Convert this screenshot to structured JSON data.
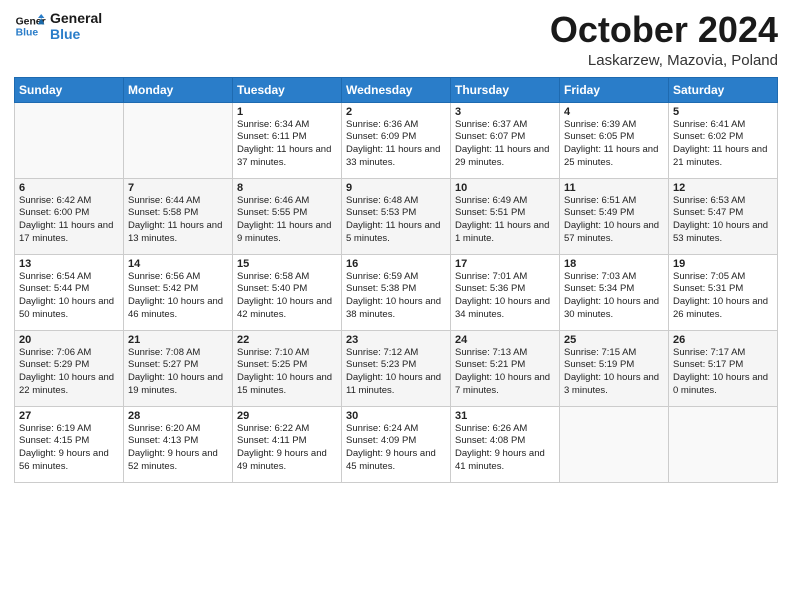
{
  "header": {
    "logo_line1": "General",
    "logo_line2": "Blue",
    "month_title": "October 2024",
    "location": "Laskarzew, Mazovia, Poland"
  },
  "days_of_week": [
    "Sunday",
    "Monday",
    "Tuesday",
    "Wednesday",
    "Thursday",
    "Friday",
    "Saturday"
  ],
  "weeks": [
    [
      {
        "day": "",
        "sunrise": "",
        "sunset": "",
        "daylight": ""
      },
      {
        "day": "",
        "sunrise": "",
        "sunset": "",
        "daylight": ""
      },
      {
        "day": "1",
        "sunrise": "Sunrise: 6:34 AM",
        "sunset": "Sunset: 6:11 PM",
        "daylight": "Daylight: 11 hours and 37 minutes."
      },
      {
        "day": "2",
        "sunrise": "Sunrise: 6:36 AM",
        "sunset": "Sunset: 6:09 PM",
        "daylight": "Daylight: 11 hours and 33 minutes."
      },
      {
        "day": "3",
        "sunrise": "Sunrise: 6:37 AM",
        "sunset": "Sunset: 6:07 PM",
        "daylight": "Daylight: 11 hours and 29 minutes."
      },
      {
        "day": "4",
        "sunrise": "Sunrise: 6:39 AM",
        "sunset": "Sunset: 6:05 PM",
        "daylight": "Daylight: 11 hours and 25 minutes."
      },
      {
        "day": "5",
        "sunrise": "Sunrise: 6:41 AM",
        "sunset": "Sunset: 6:02 PM",
        "daylight": "Daylight: 11 hours and 21 minutes."
      }
    ],
    [
      {
        "day": "6",
        "sunrise": "Sunrise: 6:42 AM",
        "sunset": "Sunset: 6:00 PM",
        "daylight": "Daylight: 11 hours and 17 minutes."
      },
      {
        "day": "7",
        "sunrise": "Sunrise: 6:44 AM",
        "sunset": "Sunset: 5:58 PM",
        "daylight": "Daylight: 11 hours and 13 minutes."
      },
      {
        "day": "8",
        "sunrise": "Sunrise: 6:46 AM",
        "sunset": "Sunset: 5:55 PM",
        "daylight": "Daylight: 11 hours and 9 minutes."
      },
      {
        "day": "9",
        "sunrise": "Sunrise: 6:48 AM",
        "sunset": "Sunset: 5:53 PM",
        "daylight": "Daylight: 11 hours and 5 minutes."
      },
      {
        "day": "10",
        "sunrise": "Sunrise: 6:49 AM",
        "sunset": "Sunset: 5:51 PM",
        "daylight": "Daylight: 11 hours and 1 minute."
      },
      {
        "day": "11",
        "sunrise": "Sunrise: 6:51 AM",
        "sunset": "Sunset: 5:49 PM",
        "daylight": "Daylight: 10 hours and 57 minutes."
      },
      {
        "day": "12",
        "sunrise": "Sunrise: 6:53 AM",
        "sunset": "Sunset: 5:47 PM",
        "daylight": "Daylight: 10 hours and 53 minutes."
      }
    ],
    [
      {
        "day": "13",
        "sunrise": "Sunrise: 6:54 AM",
        "sunset": "Sunset: 5:44 PM",
        "daylight": "Daylight: 10 hours and 50 minutes."
      },
      {
        "day": "14",
        "sunrise": "Sunrise: 6:56 AM",
        "sunset": "Sunset: 5:42 PM",
        "daylight": "Daylight: 10 hours and 46 minutes."
      },
      {
        "day": "15",
        "sunrise": "Sunrise: 6:58 AM",
        "sunset": "Sunset: 5:40 PM",
        "daylight": "Daylight: 10 hours and 42 minutes."
      },
      {
        "day": "16",
        "sunrise": "Sunrise: 6:59 AM",
        "sunset": "Sunset: 5:38 PM",
        "daylight": "Daylight: 10 hours and 38 minutes."
      },
      {
        "day": "17",
        "sunrise": "Sunrise: 7:01 AM",
        "sunset": "Sunset: 5:36 PM",
        "daylight": "Daylight: 10 hours and 34 minutes."
      },
      {
        "day": "18",
        "sunrise": "Sunrise: 7:03 AM",
        "sunset": "Sunset: 5:34 PM",
        "daylight": "Daylight: 10 hours and 30 minutes."
      },
      {
        "day": "19",
        "sunrise": "Sunrise: 7:05 AM",
        "sunset": "Sunset: 5:31 PM",
        "daylight": "Daylight: 10 hours and 26 minutes."
      }
    ],
    [
      {
        "day": "20",
        "sunrise": "Sunrise: 7:06 AM",
        "sunset": "Sunset: 5:29 PM",
        "daylight": "Daylight: 10 hours and 22 minutes."
      },
      {
        "day": "21",
        "sunrise": "Sunrise: 7:08 AM",
        "sunset": "Sunset: 5:27 PM",
        "daylight": "Daylight: 10 hours and 19 minutes."
      },
      {
        "day": "22",
        "sunrise": "Sunrise: 7:10 AM",
        "sunset": "Sunset: 5:25 PM",
        "daylight": "Daylight: 10 hours and 15 minutes."
      },
      {
        "day": "23",
        "sunrise": "Sunrise: 7:12 AM",
        "sunset": "Sunset: 5:23 PM",
        "daylight": "Daylight: 10 hours and 11 minutes."
      },
      {
        "day": "24",
        "sunrise": "Sunrise: 7:13 AM",
        "sunset": "Sunset: 5:21 PM",
        "daylight": "Daylight: 10 hours and 7 minutes."
      },
      {
        "day": "25",
        "sunrise": "Sunrise: 7:15 AM",
        "sunset": "Sunset: 5:19 PM",
        "daylight": "Daylight: 10 hours and 3 minutes."
      },
      {
        "day": "26",
        "sunrise": "Sunrise: 7:17 AM",
        "sunset": "Sunset: 5:17 PM",
        "daylight": "Daylight: 10 hours and 0 minutes."
      }
    ],
    [
      {
        "day": "27",
        "sunrise": "Sunrise: 6:19 AM",
        "sunset": "Sunset: 4:15 PM",
        "daylight": "Daylight: 9 hours and 56 minutes."
      },
      {
        "day": "28",
        "sunrise": "Sunrise: 6:20 AM",
        "sunset": "Sunset: 4:13 PM",
        "daylight": "Daylight: 9 hours and 52 minutes."
      },
      {
        "day": "29",
        "sunrise": "Sunrise: 6:22 AM",
        "sunset": "Sunset: 4:11 PM",
        "daylight": "Daylight: 9 hours and 49 minutes."
      },
      {
        "day": "30",
        "sunrise": "Sunrise: 6:24 AM",
        "sunset": "Sunset: 4:09 PM",
        "daylight": "Daylight: 9 hours and 45 minutes."
      },
      {
        "day": "31",
        "sunrise": "Sunrise: 6:26 AM",
        "sunset": "Sunset: 4:08 PM",
        "daylight": "Daylight: 9 hours and 41 minutes."
      },
      {
        "day": "",
        "sunrise": "",
        "sunset": "",
        "daylight": ""
      },
      {
        "day": "",
        "sunrise": "",
        "sunset": "",
        "daylight": ""
      }
    ]
  ]
}
